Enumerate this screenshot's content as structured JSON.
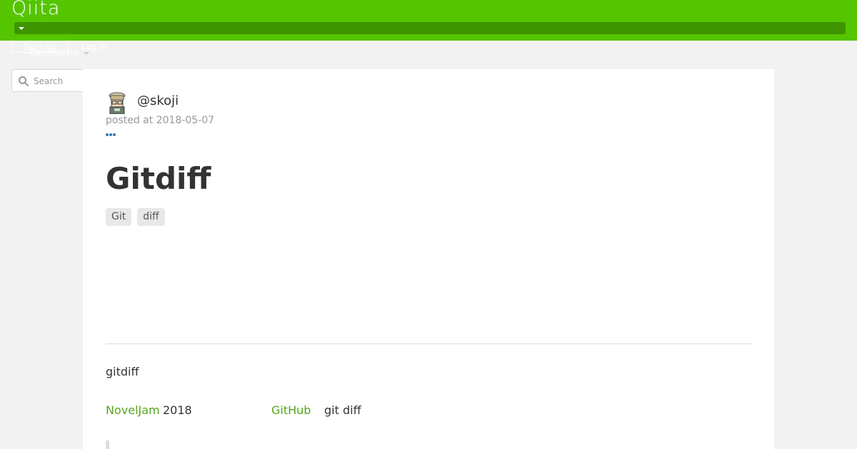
{
  "header": {
    "logo": "Qiita",
    "signup_label": "Sign up",
    "login_label": "Log in",
    "community_label": "Community"
  },
  "search": {
    "placeholder": "Search"
  },
  "article": {
    "author": "@skoji",
    "posted": "posted at 2018-05-07",
    "title": "Gitdiff",
    "tags": [
      "Git",
      "diff"
    ],
    "body_intro": "gitdiff",
    "link_noveljam": "NovelJam",
    "year": "2018",
    "link_github": "GitHub",
    "command": "git diff"
  },
  "colors": {
    "brand": "#55c500",
    "menu_bar": "#3e9400",
    "link": "#55a51c"
  },
  "icons": [
    "caret-down-icon",
    "search-icon",
    "avatar",
    "more-options-icon"
  ]
}
